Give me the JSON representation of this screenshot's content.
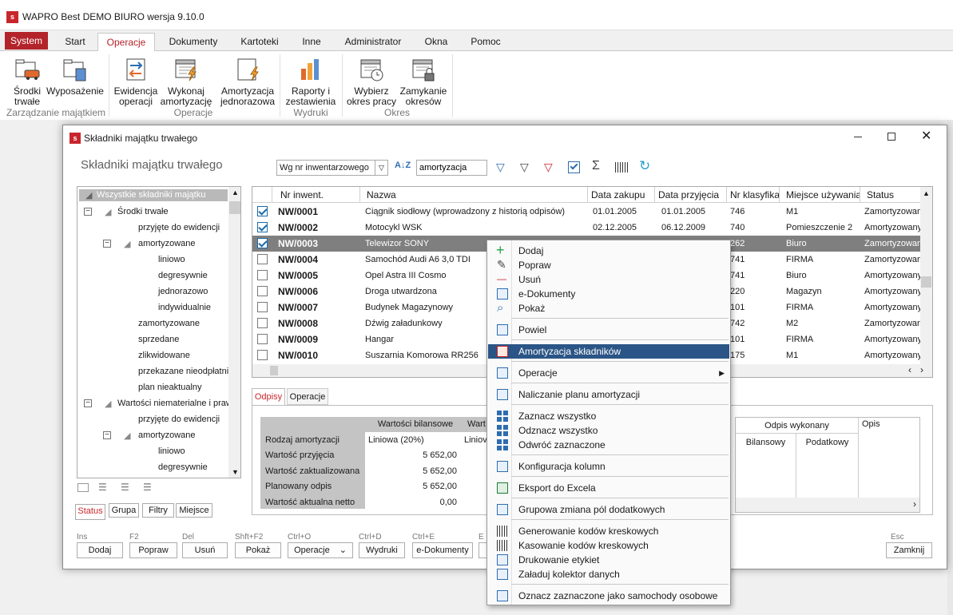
{
  "app": {
    "logo": "s",
    "title": "WAPRO Best DEMO BIURO wersja 9.10.0"
  },
  "menu": [
    "System",
    "Start",
    "Operacje",
    "Dokumenty",
    "Kartoteki",
    "Inne",
    "Administrator",
    "Okna",
    "Pomoc"
  ],
  "ribbon": {
    "srodki": [
      "Środki",
      "trwałe"
    ],
    "wyposazenie": "Wyposażenie",
    "group_zarzadzanie": "Zarządzanie majątkiem",
    "ewidencja": [
      "Ewidencja",
      "operacji"
    ],
    "wykonaj": [
      "Wykonaj",
      "amortyzację"
    ],
    "group_operacje": "Operacje",
    "amortyzacja_j": [
      "Amortyzacja",
      "jednorazowa"
    ],
    "raporty": [
      "Raporty i",
      "zestawienia"
    ],
    "group_wydruki": "Wydruki",
    "wybierz": [
      "Wybierz",
      "okres pracy"
    ],
    "zamykanie": [
      "Zamykanie",
      "okresów"
    ],
    "group_okres": "Okres"
  },
  "window": {
    "logo": "s",
    "title": "Składniki majątku trwałego",
    "heading": "Składniki majątku trwałego",
    "sort_select": "Wg nr inwentarzowego",
    "search_value": "amortyzacja",
    "tree": {
      "root": "Wszystkie składniki majątku",
      "items": [
        "Środki trwałe",
        "przyjęte do ewidencji",
        "amortyzowane",
        "liniowo",
        "degresywnie",
        "jednorazowo",
        "indywidualnie",
        "zamortyzowane",
        "sprzedane",
        "zlikwidowane",
        "przekazane nieodpłatnie",
        "plan nieaktualny",
        "Wartości niematerialne i prawne",
        "przyjęte do ewidencji",
        "amortyzowane",
        "liniowo",
        "degresywnie"
      ]
    },
    "left_tabs": [
      "Status",
      "Grupa",
      "Filtry",
      "Miejsce"
    ],
    "columns": [
      "Nr inwent.",
      "Nazwa",
      "Data zakupu",
      "Data przyjęcia",
      "Nr klasyfikac",
      "Miejsce używania",
      "Status"
    ],
    "rows": [
      {
        "nr": "NW/0001",
        "nazwa": "Ciągnik siodłowy (wprowadzony z historią odpisów)",
        "zakup": "01.01.2005",
        "przyjecie": "01.01.2005",
        "klas": "746",
        "miejsce": "M1",
        "status": "Zamortyzowany"
      },
      {
        "nr": "NW/0002",
        "nazwa": "Motocykl WSK",
        "zakup": "02.12.2005",
        "przyjecie": "06.12.2009",
        "klas": "740",
        "miejsce": "Pomieszczenie 2",
        "status": "Amortyzowany"
      },
      {
        "nr": "NW/0003",
        "nazwa": "Telewizor SONY",
        "zakup": "01.05.2009",
        "przyjecie": "01.05.2009",
        "klas": "262",
        "miejsce": "Biuro",
        "status": "Zamortyzowany"
      },
      {
        "nr": "NW/0004",
        "nazwa": "Samochód Audi A6 3,0 TDI",
        "zakup": "",
        "przyjecie": "",
        "klas": "741",
        "miejsce": "FIRMA",
        "status": "Zamortyzowany"
      },
      {
        "nr": "NW/0005",
        "nazwa": "Opel Astra III Cosmo",
        "zakup": "",
        "przyjecie": "",
        "klas": "741",
        "miejsce": "Biuro",
        "status": "Amortyzowany"
      },
      {
        "nr": "NW/0006",
        "nazwa": "Droga utwardzona",
        "zakup": "",
        "przyjecie": "",
        "klas": "220",
        "miejsce": "Magazyn",
        "status": "Amortyzowany"
      },
      {
        "nr": "NW/0007",
        "nazwa": "Budynek Magazynowy",
        "zakup": "",
        "przyjecie": "",
        "klas": "101",
        "miejsce": "FIRMA",
        "status": "Amortyzowany"
      },
      {
        "nr": "NW/0008",
        "nazwa": "Dźwig załadunkowy",
        "zakup": "",
        "przyjecie": "",
        "klas": "742",
        "miejsce": "M2",
        "status": "Zamortyzowany"
      },
      {
        "nr": "NW/0009",
        "nazwa": "Hangar",
        "zakup": "",
        "przyjecie": "",
        "klas": "101",
        "miejsce": "FIRMA",
        "status": "Amortyzowany"
      },
      {
        "nr": "NW/0010",
        "nazwa": "Suszarnia Komorowa RR256",
        "zakup": "",
        "przyjecie": "",
        "klas": "175",
        "miejsce": "M1",
        "status": "Amortyzowany"
      }
    ],
    "bottom_tabs": [
      "Odpisy",
      "Operacje"
    ],
    "values": {
      "header_bil": "Wartości bilansowe",
      "header_war": "Wart",
      "rows": [
        {
          "label": "Rodzaj amortyzacji",
          "val": "Liniowa (20%)",
          "val2": "Liniov"
        },
        {
          "label": "Wartość przyjęcia",
          "val": "5 652,00"
        },
        {
          "label": "Wartość zaktualizowana",
          "val": "5 652,00"
        },
        {
          "label": "Planowany odpis",
          "val": "5 652,00"
        },
        {
          "label": "Wartość aktualna netto",
          "val": "0,00"
        }
      ],
      "odpis_wykonany": "Odpis wykonany",
      "opis": "Opis",
      "bilansowy": "Bilansowy",
      "podatkowy": "Podatkowy"
    },
    "buttons": [
      {
        "sc": "Ins",
        "label": "Dodaj"
      },
      {
        "sc": "F2",
        "label": "Popraw"
      },
      {
        "sc": "Del",
        "label": "Usuń"
      },
      {
        "sc": "Shft+F2",
        "label": "Pokaż"
      },
      {
        "sc": "Ctrl+O",
        "label": "Operacje"
      },
      {
        "sc": "Ctrl+D",
        "label": "Wydruki"
      },
      {
        "sc": "Ctrl+E",
        "label": "e-Dokumenty"
      },
      {
        "sc": "E",
        "label": ""
      }
    ],
    "close": {
      "sc": "Esc",
      "label": "Zamknij"
    }
  },
  "context_menu": [
    {
      "label": "Dodaj",
      "icon": "plus-icon"
    },
    {
      "label": "Popraw",
      "icon": "pencil-icon"
    },
    {
      "label": "Usuń",
      "icon": "minus-icon"
    },
    {
      "label": "e-Dokumenty",
      "icon": "document-icon"
    },
    {
      "label": "Pokaż",
      "icon": "magnifier-icon"
    },
    {
      "label": "Powiel",
      "icon": "copy-icon"
    },
    {
      "label": "Amortyzacja składników",
      "icon": "calculator-icon"
    },
    {
      "label": "Operacje",
      "icon": "list-icon"
    },
    {
      "label": "Naliczanie planu amortyzacji",
      "icon": "plan-icon"
    },
    {
      "label": "Zaznacz wszystko",
      "icon": "select-all-icon"
    },
    {
      "label": "Odznacz wszystko",
      "icon": "deselect-all-icon"
    },
    {
      "label": "Odwróć zaznaczone",
      "icon": "invert-selection-icon"
    },
    {
      "label": "Konfiguracja kolumn",
      "icon": "columns-icon"
    },
    {
      "label": "Eksport do Excela",
      "icon": "excel-icon"
    },
    {
      "label": "Grupowa zmiana pól dodatkowych",
      "icon": "group-edit-icon"
    },
    {
      "label": "Generowanie kodów kreskowych",
      "icon": "barcode-icon"
    },
    {
      "label": "Kasowanie kodów kreskowych",
      "icon": "barcode-delete-icon"
    },
    {
      "label": "Drukowanie etykiet",
      "icon": "printer-icon"
    },
    {
      "label": "Załaduj kolektor danych",
      "icon": "collector-icon"
    },
    {
      "label": "Oznacz zaznaczone jako samochody osobowe",
      "icon": "car-icon"
    }
  ]
}
